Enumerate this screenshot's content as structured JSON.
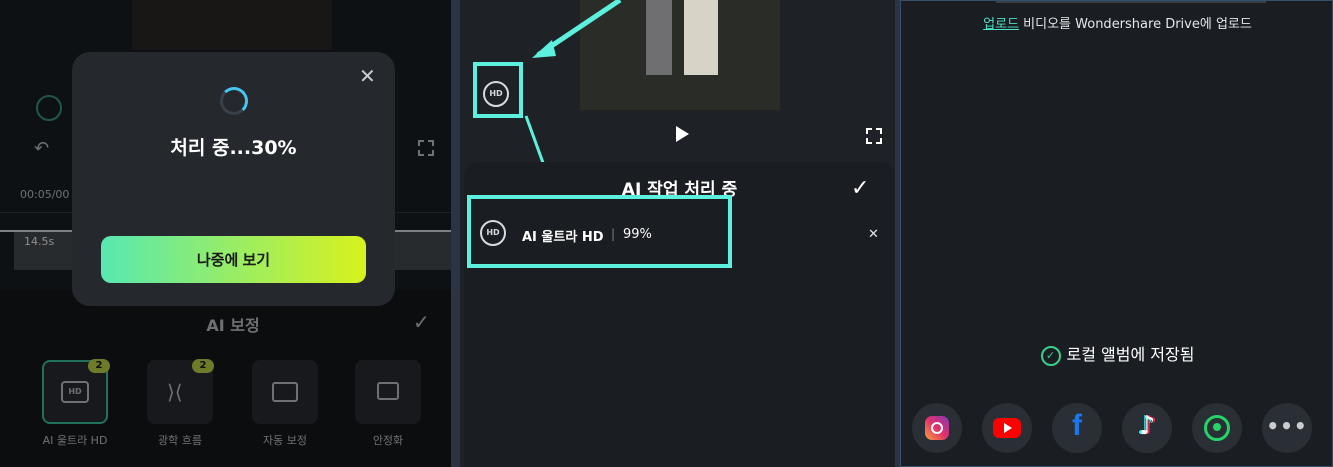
{
  "left_panel": {
    "timestamp": "00:05/00",
    "clip_duration": "14.5s",
    "section_title": "AI 보정",
    "tools": [
      {
        "label": "AI 울트라 HD",
        "badge": "2",
        "icon": "hd-ai-icon",
        "selected": true
      },
      {
        "label": "광학 흐름",
        "badge": "2",
        "icon": "optical-flow-icon",
        "selected": false
      },
      {
        "label": "자동 보정",
        "badge": "",
        "icon": "auto-correct-icon",
        "selected": false
      },
      {
        "label": "안정화",
        "badge": "",
        "icon": "stabilize-icon",
        "selected": false
      }
    ],
    "modal": {
      "title": "처리 중...30%",
      "button": "나중에 보기"
    }
  },
  "middle_panel": {
    "sheet_title": "AI 작업 처리 중",
    "task": {
      "name": "AI 울트라 HD",
      "progress_text": "99%"
    }
  },
  "right_panel": {
    "upload_link": "업로드",
    "upload_text": " 비디오를 Wondershare Drive에 업로드",
    "saved_text": "로컬 앨범에 저장됨",
    "share_icons": [
      "instagram-icon",
      "youtube-icon",
      "facebook-icon",
      "tiktok-icon",
      "whatsapp-icon",
      "more-icon"
    ]
  },
  "colors": {
    "accent": "#5cf0de",
    "progress_blue": "#46c5f5",
    "button_gradient_start": "#58e8b0",
    "button_gradient_end": "#d8f21c"
  }
}
